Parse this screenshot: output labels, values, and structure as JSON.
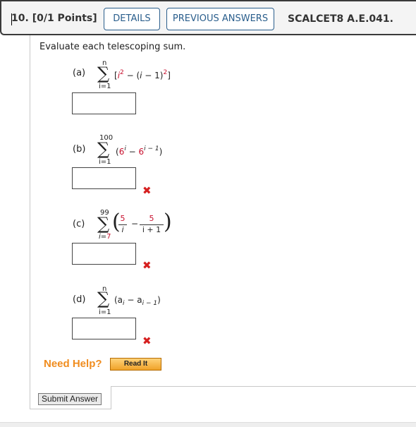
{
  "header": {
    "question_number": "10.",
    "points": "[0/1 Points]",
    "details_label": "DETAILS",
    "previous_answers_label": "PREVIOUS ANSWERS",
    "course_code": "SCALCET8 A.E.041."
  },
  "prompt": "Evaluate each telescoping sum.",
  "parts": [
    {
      "label": "(a)",
      "upper": "n",
      "lower": "i=1",
      "answer": "",
      "status": ""
    },
    {
      "label": "(b)",
      "upper": "100",
      "lower": "i=1",
      "answer": "",
      "status": "incorrect"
    },
    {
      "label": "(c)",
      "upper": "99",
      "lower_var": "i=",
      "lower_val": "7",
      "answer": "",
      "status": "incorrect"
    },
    {
      "label": "(d)",
      "upper": "n",
      "lower": "i=1",
      "answer": "",
      "status": "incorrect"
    }
  ],
  "expr": {
    "a_open": "[",
    "a_i": "i",
    "a_exp1": "2",
    "a_mid": " − (",
    "a_i2": "i",
    "a_minus": " − 1)",
    "a_exp2": "2",
    "a_close": "]",
    "b_open": "(",
    "b_base1": "6",
    "b_exp1": "i",
    "b_mid": " − ",
    "b_base2": "6",
    "b_exp2": "i − 1",
    "b_close": ")",
    "c_num1": "5",
    "c_den1": "i",
    "c_minus": "−",
    "c_num2": "5",
    "c_den2": "i + 1",
    "d_open": "(a",
    "d_sub1": "i",
    "d_mid": " − a",
    "d_sub2": "i − 1",
    "d_close": ")"
  },
  "help": {
    "need_help_label": "Need Help?",
    "read_it_label": "Read It"
  },
  "submit_label": "Submit Answer",
  "icons": {
    "incorrect": "✖",
    "sigma": "∑"
  },
  "colors": {
    "accent_blue": "#2a5e8c",
    "incorrect_red": "#d62020",
    "need_help_orange": "#f08c1e",
    "math_red": "#c8102e"
  }
}
